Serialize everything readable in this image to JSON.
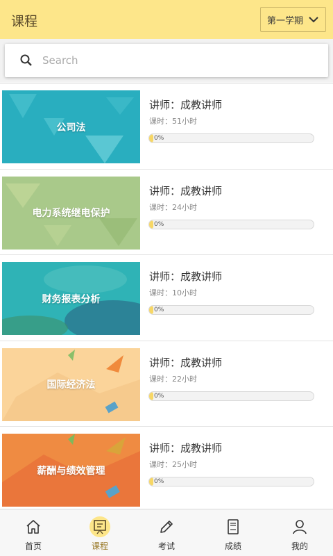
{
  "header": {
    "title": "课程",
    "term_select": "第一学期",
    "term_icon": "chevron-down-icon"
  },
  "search": {
    "placeholder": "Search",
    "value": "",
    "icon": "search-icon"
  },
  "courses": [
    {
      "title": "公司法",
      "teacher": "讲师：成教讲师",
      "hours": "课时：51小时",
      "progress": 0,
      "progress_text": "0%",
      "bg": "#29aebf"
    },
    {
      "title": "电力系统继电保护",
      "teacher": "讲师：成教讲师",
      "hours": "课时：24小时",
      "progress": 0,
      "progress_text": "0%",
      "bg": "#a9c98a"
    },
    {
      "title": "财务报表分析",
      "teacher": "讲师：成教讲师",
      "hours": "课时：10小时",
      "progress": 0,
      "progress_text": "0%",
      "bg": "#2fb3b6"
    },
    {
      "title": "国际经济法",
      "teacher": "讲师：成教讲师",
      "hours": "课时：22小时",
      "progress": 0,
      "progress_text": "0%",
      "bg": "#fbd49a"
    },
    {
      "title": "薪酬与绩效管理",
      "teacher": "讲师：成教讲师",
      "hours": "课时：25小时",
      "progress": 0,
      "progress_text": "0%",
      "bg": "#ef8b42"
    }
  ],
  "tabs": [
    {
      "label": "首页",
      "icon": "home-icon",
      "active": false
    },
    {
      "label": "课程",
      "icon": "course-board-icon",
      "active": true
    },
    {
      "label": "考试",
      "icon": "pencil-icon",
      "active": false
    },
    {
      "label": "成绩",
      "icon": "score-sheet-icon",
      "active": false
    },
    {
      "label": "我的",
      "icon": "user-icon",
      "active": false
    }
  ],
  "colors": {
    "header_bg": "#fde68a",
    "progress_fill": "#f7d766",
    "active_tab": "#9a7a2a"
  }
}
